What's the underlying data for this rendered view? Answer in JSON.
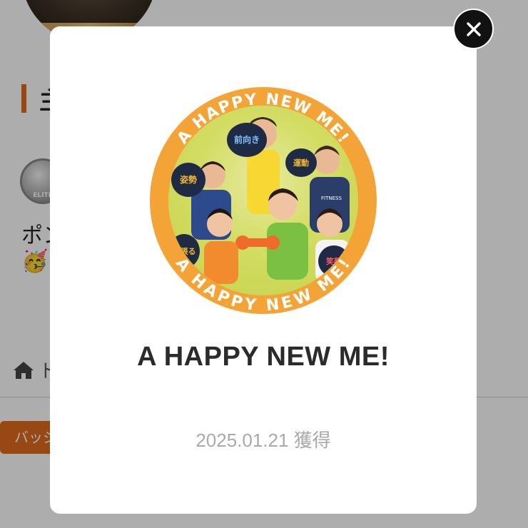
{
  "background": {
    "section_title": "主",
    "text_line": "ポン",
    "emoji": "🥳",
    "home_label": "ト",
    "button_label": "バッジ"
  },
  "modal": {
    "badge": {
      "ring_text_top": "A HAPPY NEW ME!",
      "ring_text_bottom": "A HAPPY NEW ME!",
      "sign_labels": [
        "前向き",
        "姿勢",
        "運動",
        "笑顔",
        "頑張る"
      ],
      "shirt_text": "FITNESS"
    },
    "title": "A HAPPY NEW ME!",
    "earned_date": "2025.01.21 獲得"
  },
  "colors": {
    "accent": "#e06a1b",
    "badge_ring": "#f4a437",
    "badge_bg": "#d3dd63",
    "date_text": "#a9a9a9"
  },
  "icons": {
    "close": "close-icon",
    "home": "home-icon"
  }
}
